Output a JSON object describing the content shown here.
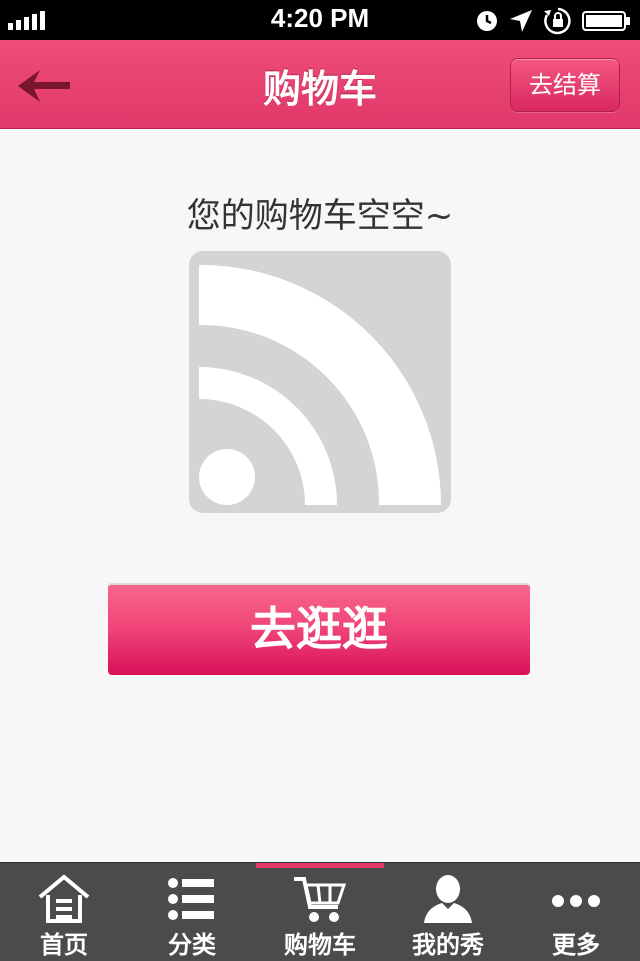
{
  "status_bar": {
    "time": "4:20 PM",
    "icons": [
      "signal-icon",
      "clock-icon",
      "location-icon",
      "rotation-lock-icon",
      "battery-icon"
    ]
  },
  "nav": {
    "title": "购物车",
    "checkout_label": "去结算",
    "back_icon": "back-arrow-icon"
  },
  "content": {
    "empty_message": "您的购物车空空~",
    "browse_label": "去逛逛",
    "placeholder_icon": "rss-icon"
  },
  "tabbar": {
    "active": "购物车",
    "items": [
      {
        "label": "首页",
        "icon": "home-icon"
      },
      {
        "label": "分类",
        "icon": "list-icon"
      },
      {
        "label": "购物车",
        "icon": "cart-icon"
      },
      {
        "label": "我的秀",
        "icon": "user-icon"
      },
      {
        "label": "更多",
        "icon": "more-icon"
      }
    ]
  },
  "colors": {
    "accent": "#e63a6d",
    "nav_bg": "#e73f70",
    "tabbar_bg": "#4b4b4b",
    "page_bg": "#f7f7f7"
  }
}
